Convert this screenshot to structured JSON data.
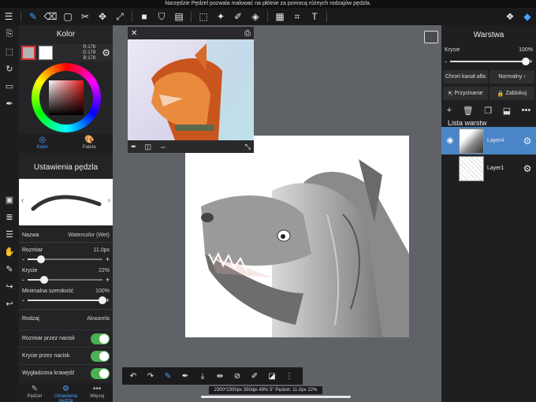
{
  "status_message": "Narzędzie Pędzel pozwala malować na płótnie za pomocą różnych rodzajów pędzla.",
  "toolbar": {
    "items": [
      {
        "icon": "menu-icon",
        "glyph": "☰"
      },
      {
        "icon": "brush-icon",
        "glyph": "✎",
        "active": true
      },
      {
        "icon": "eraser-icon",
        "glyph": "⌫"
      },
      {
        "icon": "rectangle-icon",
        "glyph": "▢"
      },
      {
        "icon": "smudge-icon",
        "glyph": "✂"
      },
      {
        "icon": "move-icon",
        "glyph": "✥"
      },
      {
        "icon": "transform-icon",
        "glyph": "⤢"
      },
      {
        "icon": "fill-color-icon",
        "glyph": "■"
      },
      {
        "icon": "bucket-icon",
        "glyph": "⛉"
      },
      {
        "icon": "gradient-icon",
        "glyph": "▤"
      },
      {
        "icon": "selection-icon",
        "glyph": "⬚"
      },
      {
        "icon": "magic-wand-icon",
        "glyph": "✦"
      },
      {
        "icon": "select-pen-icon",
        "glyph": "✐"
      },
      {
        "icon": "select-eraser-icon",
        "glyph": "◈"
      },
      {
        "icon": "frame-divider-icon",
        "glyph": "▦"
      },
      {
        "icon": "crop-icon",
        "glyph": "⌗"
      },
      {
        "icon": "text-icon",
        "glyph": "T"
      },
      {
        "icon": "materials-icon",
        "glyph": "❖"
      },
      {
        "icon": "layers-icon",
        "glyph": "◆",
        "active": true
      }
    ]
  },
  "leftbar": {
    "items": [
      {
        "icon": "copy-icon",
        "glyph": "⎘"
      },
      {
        "icon": "dashed-select-icon",
        "glyph": "⬚"
      },
      {
        "icon": "rotate-icon",
        "glyph": "↻"
      },
      {
        "icon": "ruler-icon",
        "glyph": "▭"
      },
      {
        "icon": "pen-icon",
        "glyph": "✒"
      }
    ],
    "lower": [
      {
        "icon": "color-panel-icon",
        "glyph": "▣"
      },
      {
        "icon": "list-icon",
        "glyph": "≣"
      },
      {
        "icon": "layers-small-icon",
        "glyph": "☰"
      },
      {
        "icon": "hand-icon",
        "glyph": "✋"
      },
      {
        "icon": "eyedropper-icon",
        "glyph": "✎"
      },
      {
        "icon": "redo-icon",
        "glyph": "↪"
      },
      {
        "icon": "undo-icon",
        "glyph": "↩"
      }
    ]
  },
  "color_panel": {
    "title": "Kolor",
    "rgb_r": "R:178",
    "rgb_g": "G:178",
    "rgb_b": "B:178",
    "primary_color": "#b2b2b2",
    "secondary_color": "#ffffff",
    "tabs": [
      {
        "label": "Kolor",
        "glyph": "◎",
        "active": true
      },
      {
        "label": "Paleta",
        "glyph": "🎨",
        "active": false
      }
    ]
  },
  "brush_panel": {
    "title": "Ustawienia pędzla",
    "name_label": "Nazwa",
    "name_value": "Watercolor (Wet)",
    "size_label": "Rozmiar",
    "size_value": "11.0px",
    "size_level": 0.18,
    "opacity_label": "Krycie",
    "opacity_value": "22%",
    "opacity_level": 0.22,
    "min_width_label": "Minimalna szerokość",
    "min_width_value": "100%",
    "min_width_level": 1.0,
    "type_label": "Rodzaj",
    "type_value": "Akwarela",
    "toggles": [
      {
        "label": "Rozmiar przez nacisk",
        "on": true
      },
      {
        "label": "Krycie przez nacisk",
        "on": true
      },
      {
        "label": "Wygładzona krawędź",
        "on": true
      }
    ],
    "bottom_tabs": [
      {
        "label": "Pędzel",
        "glyph": "✎",
        "active": false
      },
      {
        "label": "Ustawienia pędzla",
        "glyph": "⚙",
        "active": true
      },
      {
        "label": "Więcej",
        "glyph": "•••",
        "active": false
      }
    ]
  },
  "canvas": {
    "status": "2300*2300px 350dpi 49% 5° Pędzel: 11.0px 22%"
  },
  "bottom_tools": [
    {
      "icon": "undo-arrow-icon",
      "glyph": "↶"
    },
    {
      "icon": "redo-arrow-icon",
      "glyph": "↷"
    },
    {
      "icon": "brush-mode-icon",
      "glyph": "✎",
      "active": true
    },
    {
      "icon": "eyedropper-tool-icon",
      "glyph": "✒"
    },
    {
      "icon": "save-down-icon",
      "glyph": "⤓"
    },
    {
      "icon": "flip-icon",
      "glyph": "⇹"
    },
    {
      "icon": "no-rotate-icon",
      "glyph": "⊘"
    },
    {
      "icon": "edit-layer-icon",
      "glyph": "✐"
    },
    {
      "icon": "screen-icon",
      "glyph": "◪"
    },
    {
      "icon": "grip-icon",
      "glyph": "⋮"
    }
  ],
  "layer_panel": {
    "title": "Warstwa",
    "opacity_label": "Krycie",
    "opacity_value": "100%",
    "opacity_level": 1.0,
    "protect_alpha": "Chroń kanał alfa",
    "blend_mode": "Normalny",
    "clipping": "Przycinanie",
    "lock": "Zablokuj",
    "list_title": "Lista warstw",
    "layers": [
      {
        "name": "Layer4",
        "selected": true
      },
      {
        "name": "Layer1",
        "selected": false
      }
    ]
  }
}
